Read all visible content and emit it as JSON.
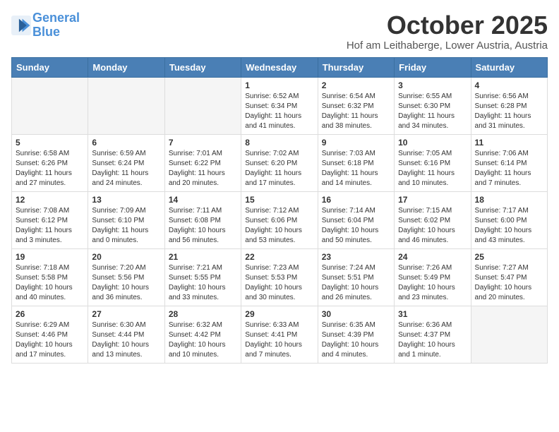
{
  "logo": {
    "line1": "General",
    "line2": "Blue"
  },
  "title": "October 2025",
  "location": "Hof am Leithaberge, Lower Austria, Austria",
  "weekdays": [
    "Sunday",
    "Monday",
    "Tuesday",
    "Wednesday",
    "Thursday",
    "Friday",
    "Saturday"
  ],
  "weeks": [
    [
      {
        "day": "",
        "info": ""
      },
      {
        "day": "",
        "info": ""
      },
      {
        "day": "",
        "info": ""
      },
      {
        "day": "1",
        "info": "Sunrise: 6:52 AM\nSunset: 6:34 PM\nDaylight: 11 hours\nand 41 minutes."
      },
      {
        "day": "2",
        "info": "Sunrise: 6:54 AM\nSunset: 6:32 PM\nDaylight: 11 hours\nand 38 minutes."
      },
      {
        "day": "3",
        "info": "Sunrise: 6:55 AM\nSunset: 6:30 PM\nDaylight: 11 hours\nand 34 minutes."
      },
      {
        "day": "4",
        "info": "Sunrise: 6:56 AM\nSunset: 6:28 PM\nDaylight: 11 hours\nand 31 minutes."
      }
    ],
    [
      {
        "day": "5",
        "info": "Sunrise: 6:58 AM\nSunset: 6:26 PM\nDaylight: 11 hours\nand 27 minutes."
      },
      {
        "day": "6",
        "info": "Sunrise: 6:59 AM\nSunset: 6:24 PM\nDaylight: 11 hours\nand 24 minutes."
      },
      {
        "day": "7",
        "info": "Sunrise: 7:01 AM\nSunset: 6:22 PM\nDaylight: 11 hours\nand 20 minutes."
      },
      {
        "day": "8",
        "info": "Sunrise: 7:02 AM\nSunset: 6:20 PM\nDaylight: 11 hours\nand 17 minutes."
      },
      {
        "day": "9",
        "info": "Sunrise: 7:03 AM\nSunset: 6:18 PM\nDaylight: 11 hours\nand 14 minutes."
      },
      {
        "day": "10",
        "info": "Sunrise: 7:05 AM\nSunset: 6:16 PM\nDaylight: 11 hours\nand 10 minutes."
      },
      {
        "day": "11",
        "info": "Sunrise: 7:06 AM\nSunset: 6:14 PM\nDaylight: 11 hours\nand 7 minutes."
      }
    ],
    [
      {
        "day": "12",
        "info": "Sunrise: 7:08 AM\nSunset: 6:12 PM\nDaylight: 11 hours\nand 3 minutes."
      },
      {
        "day": "13",
        "info": "Sunrise: 7:09 AM\nSunset: 6:10 PM\nDaylight: 11 hours\nand 0 minutes."
      },
      {
        "day": "14",
        "info": "Sunrise: 7:11 AM\nSunset: 6:08 PM\nDaylight: 10 hours\nand 56 minutes."
      },
      {
        "day": "15",
        "info": "Sunrise: 7:12 AM\nSunset: 6:06 PM\nDaylight: 10 hours\nand 53 minutes."
      },
      {
        "day": "16",
        "info": "Sunrise: 7:14 AM\nSunset: 6:04 PM\nDaylight: 10 hours\nand 50 minutes."
      },
      {
        "day": "17",
        "info": "Sunrise: 7:15 AM\nSunset: 6:02 PM\nDaylight: 10 hours\nand 46 minutes."
      },
      {
        "day": "18",
        "info": "Sunrise: 7:17 AM\nSunset: 6:00 PM\nDaylight: 10 hours\nand 43 minutes."
      }
    ],
    [
      {
        "day": "19",
        "info": "Sunrise: 7:18 AM\nSunset: 5:58 PM\nDaylight: 10 hours\nand 40 minutes."
      },
      {
        "day": "20",
        "info": "Sunrise: 7:20 AM\nSunset: 5:56 PM\nDaylight: 10 hours\nand 36 minutes."
      },
      {
        "day": "21",
        "info": "Sunrise: 7:21 AM\nSunset: 5:55 PM\nDaylight: 10 hours\nand 33 minutes."
      },
      {
        "day": "22",
        "info": "Sunrise: 7:23 AM\nSunset: 5:53 PM\nDaylight: 10 hours\nand 30 minutes."
      },
      {
        "day": "23",
        "info": "Sunrise: 7:24 AM\nSunset: 5:51 PM\nDaylight: 10 hours\nand 26 minutes."
      },
      {
        "day": "24",
        "info": "Sunrise: 7:26 AM\nSunset: 5:49 PM\nDaylight: 10 hours\nand 23 minutes."
      },
      {
        "day": "25",
        "info": "Sunrise: 7:27 AM\nSunset: 5:47 PM\nDaylight: 10 hours\nand 20 minutes."
      }
    ],
    [
      {
        "day": "26",
        "info": "Sunrise: 6:29 AM\nSunset: 4:46 PM\nDaylight: 10 hours\nand 17 minutes."
      },
      {
        "day": "27",
        "info": "Sunrise: 6:30 AM\nSunset: 4:44 PM\nDaylight: 10 hours\nand 13 minutes."
      },
      {
        "day": "28",
        "info": "Sunrise: 6:32 AM\nSunset: 4:42 PM\nDaylight: 10 hours\nand 10 minutes."
      },
      {
        "day": "29",
        "info": "Sunrise: 6:33 AM\nSunset: 4:41 PM\nDaylight: 10 hours\nand 7 minutes."
      },
      {
        "day": "30",
        "info": "Sunrise: 6:35 AM\nSunset: 4:39 PM\nDaylight: 10 hours\nand 4 minutes."
      },
      {
        "day": "31",
        "info": "Sunrise: 6:36 AM\nSunset: 4:37 PM\nDaylight: 10 hours\nand 1 minute."
      },
      {
        "day": "",
        "info": ""
      }
    ]
  ]
}
